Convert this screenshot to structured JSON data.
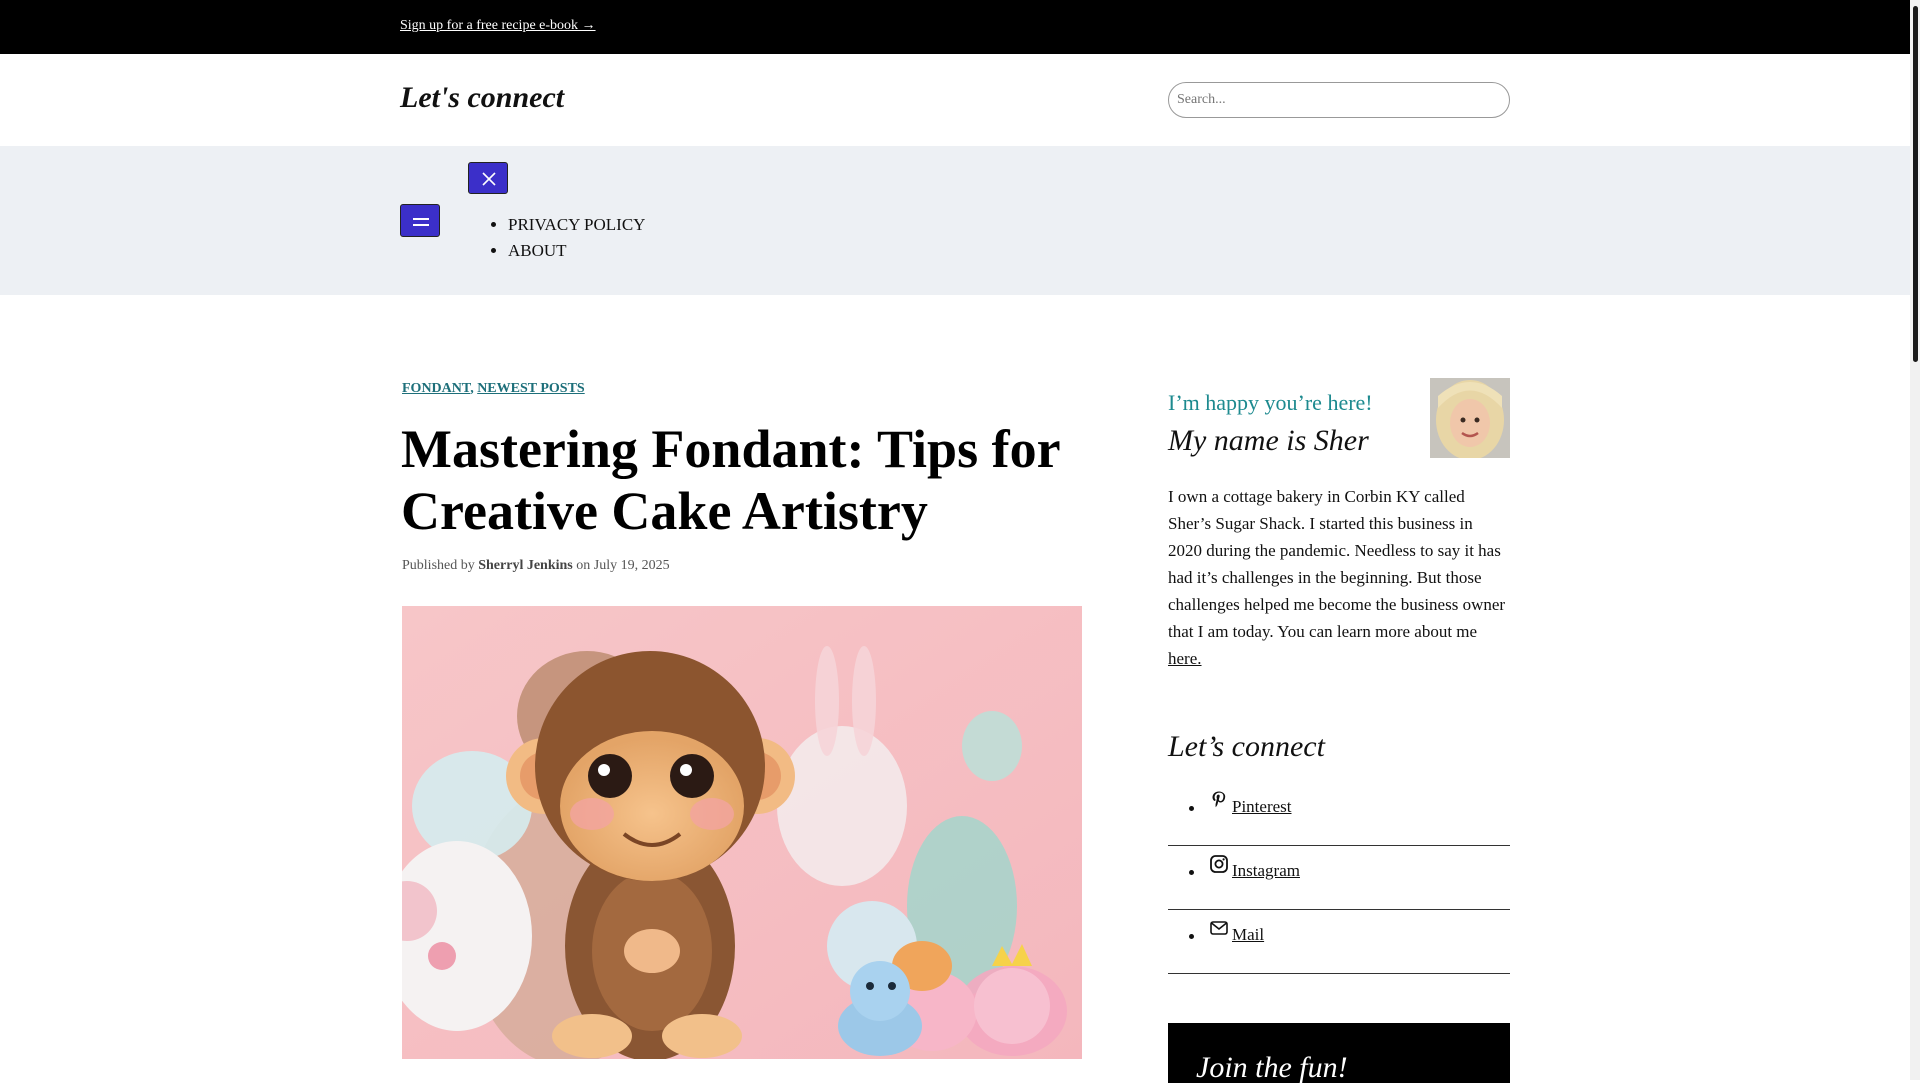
{
  "topbar": {
    "signup_link": "Sign up for a free recipe e-book →"
  },
  "header": {
    "site_title": "Let's connect",
    "search_placeholder": "Search..."
  },
  "nav": {
    "menu_icon": "hamburger-icon",
    "close_icon": "close-icon",
    "items": [
      {
        "label": "PRIVACY POLICY"
      },
      {
        "label": "ABOUT"
      }
    ],
    "button_color": "#3b2fc9"
  },
  "post": {
    "categories": [
      "FONDANT",
      "NEWEST POSTS"
    ],
    "category_separator": ",",
    "title": "Mastering Fondant: Tips for Creative Cake Artistry",
    "byline_prefix": "Published by",
    "author": "Sherryl Jenkins",
    "byline_mid": "on",
    "date": "July 19, 2025"
  },
  "sidebar": {
    "greeting": "I’m happy you’re here!",
    "name": "My name is Sher",
    "bio": "I own a cottage bakery in Corbin KY called Sher’s Sugar Shack. I started this business in 2020 during the pandemic. Needless to say it has had it’s challenges in the beginning. But those challenges helped me become the business owner that I am today. You can learn more about me",
    "bio_link": " here.",
    "connect_heading": "Let’s connect",
    "social": [
      {
        "label": "Pinterest",
        "icon": "pinterest-icon"
      },
      {
        "label": "Instagram",
        "icon": "instagram-icon"
      },
      {
        "label": "Mail",
        "icon": "mail-icon"
      }
    ],
    "join_heading": "Join the fun!"
  },
  "colors": {
    "accent_teal": "#1d8a8f",
    "category_link": "#1d6f7a",
    "nav_band": "#edf0f4"
  }
}
